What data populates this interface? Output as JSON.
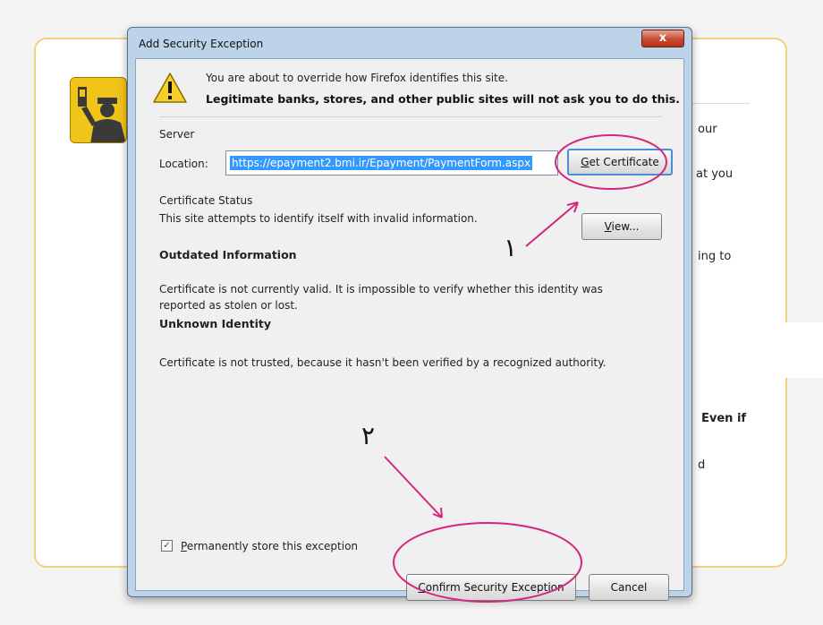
{
  "background": {
    "fragments": [
      "our",
      "at you",
      "ing to",
      "Even if",
      "d"
    ]
  },
  "dialog": {
    "title": "Add Security Exception",
    "close_label": "x",
    "warning_line1": "You are about to override how Firefox identifies this site.",
    "warning_line2": "Legitimate banks, stores, and other public sites will not ask you to do this.",
    "server_label": "Server",
    "location_label": "Location:",
    "location_value": "https://epayment2.bmi.ir/Epayment/PaymentForm.aspx",
    "get_certificate": {
      "prefix": "",
      "mnemonic": "G",
      "rest": "et Certificate"
    },
    "certificate_status_label": "Certificate Status",
    "certificate_status_text": "This site attempts to identify itself with invalid information.",
    "view": {
      "prefix": "",
      "mnemonic": "V",
      "rest": "iew..."
    },
    "outdated_heading": "Outdated Information",
    "outdated_text": "Certificate is not currently valid. It is impossible to verify whether this identity was reported as stolen or lost.",
    "unknown_heading": "Unknown Identity",
    "unknown_text": "Certificate is not trusted, because it hasn't been verified by a recognized authority.",
    "permanent_checkbox": {
      "checked": true,
      "mnemonic": "P",
      "rest": "ermanently store this exception"
    },
    "confirm": {
      "mnemonic": "C",
      "rest": "onfirm Security Exception"
    },
    "cancel_label": "Cancel"
  },
  "annotations": {
    "step1_label": "١",
    "step2_label": "٢",
    "color": "#d4267a"
  },
  "colors": {
    "selection": "#3399ff",
    "dialog_frame": "#bcd3ea",
    "close_button": "#c74a32",
    "page_border": "#f0d27a",
    "icon_yellow": "#f0c419"
  }
}
